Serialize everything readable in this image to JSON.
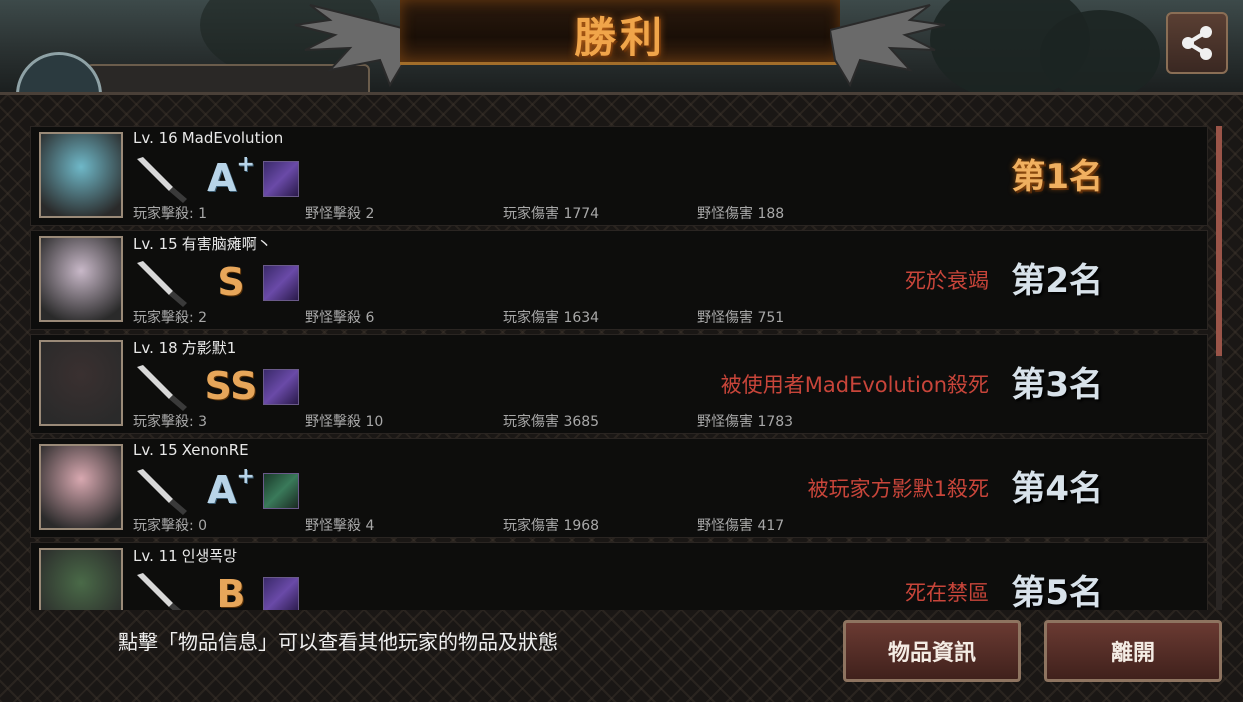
{
  "header": {
    "title": "勝利",
    "icons": {
      "share": "share-icon"
    }
  },
  "players": [
    {
      "level": "Lv. 16",
      "name": "MadEvolution",
      "grade": "A",
      "grade_plus": "+",
      "grade_style": "white",
      "item": "purple",
      "player_kills": "玩家擊殺: 1",
      "monster_kills": "野怪擊殺 2",
      "player_damage": "玩家傷害 1774",
      "monster_damage": "野怪傷害 188",
      "death": "",
      "rank": "第1名",
      "portrait_color": "#6fb8c8"
    },
    {
      "level": "Lv. 15",
      "name": "有害脑瘫啊丶",
      "grade": "S",
      "grade_plus": "",
      "grade_style": "gold",
      "item": "purple",
      "player_kills": "玩家擊殺: 2",
      "monster_kills": "野怪擊殺 6",
      "player_damage": "玩家傷害 1634",
      "monster_damage": "野怪傷害 751",
      "death": "死於衰竭",
      "rank": "第2名",
      "portrait_color": "#c8b8c8"
    },
    {
      "level": "Lv. 18",
      "name": "方影默1",
      "grade": "SS",
      "grade_plus": "",
      "grade_style": "gold",
      "item": "purple",
      "player_kills": "玩家擊殺: 3",
      "monster_kills": "野怪擊殺 10",
      "player_damage": "玩家傷害 3685",
      "monster_damage": "野怪傷害 1783",
      "death": "被使用者MadEvolution殺死",
      "rank": "第3名",
      "portrait_color": "#3a3030"
    },
    {
      "level": "Lv. 15",
      "name": "XenonRE",
      "grade": "A",
      "grade_plus": "+",
      "grade_style": "white",
      "item": "green",
      "player_kills": "玩家擊殺: 0",
      "monster_kills": "野怪擊殺 4",
      "player_damage": "玩家傷害 1968",
      "monster_damage": "野怪傷害 417",
      "death": "被玩家方影默1殺死",
      "rank": "第4名",
      "portrait_color": "#d8a8b0"
    },
    {
      "level": "Lv. 11",
      "name": "인생폭망",
      "grade": "B",
      "grade_plus": "",
      "grade_style": "gold",
      "item": "purple",
      "player_kills": "",
      "monster_kills": "",
      "player_damage": "",
      "monster_damage": "",
      "death": "死在禁區",
      "rank": "第5名",
      "portrait_color": "#4a6a48"
    }
  ],
  "footer": {
    "hint": "點擊「物品信息」可以查看其他玩家的物品及狀態",
    "items_button": "物品資訊",
    "leave_button": "離開"
  },
  "colors": {
    "death_text": "#c8453a",
    "rank_gold": "#f0b060",
    "button": "#6a3a32"
  }
}
